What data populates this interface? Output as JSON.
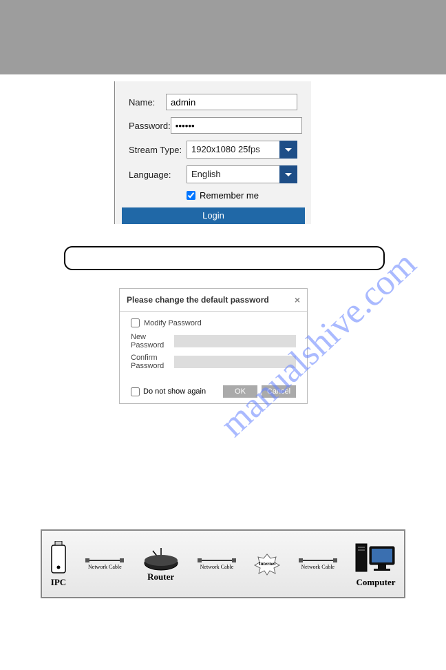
{
  "watermark": "manualshive.com",
  "login": {
    "name_label": "Name:",
    "name_value": "admin",
    "password_label": "Password:",
    "password_value": "••••••",
    "stream_label": "Stream Type:",
    "stream_value": "1920x1080 25fps",
    "language_label": "Language:",
    "language_value": "English",
    "remember_label": "Remember me",
    "login_btn": "Login"
  },
  "modal": {
    "title": "Please change the default password",
    "close": "×",
    "modify_label": "Modify Password",
    "new_pw_label": "New Password",
    "confirm_pw_label": "Confirm Password",
    "do_not_show": "Do not show again",
    "ok": "OK",
    "cancel": "Cancel"
  },
  "diagram": {
    "ipc": "IPC",
    "router": "Router",
    "internet": "Internet",
    "computer": "Computer",
    "cable": "Network Cable"
  }
}
